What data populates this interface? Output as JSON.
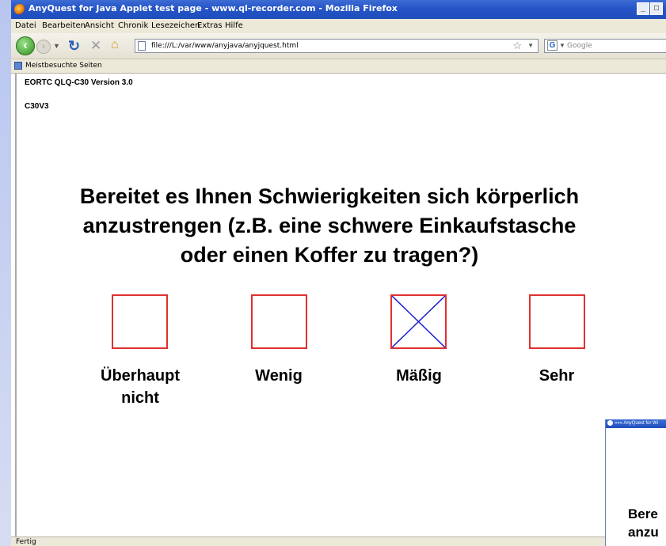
{
  "window": {
    "title": "AnyQuest for Java Applet test page - www.ql-recorder.com - Mozilla Firefox",
    "controls": [
      "_",
      "□"
    ]
  },
  "menu": [
    "Datei",
    "Bearbeiten",
    "Ansicht",
    "Chronik",
    "Lesezeichen",
    "Extras",
    "Hilfe"
  ],
  "toolbar": {
    "url": "file:///L:/var/www/anyjava/anyjquest.html",
    "search_placeholder": "Google",
    "search_engine_letter": "G"
  },
  "bookmarks": {
    "item": "Meistbesuchte Seiten"
  },
  "page": {
    "heading1": "EORTC QLQ-C30 Version 3.0",
    "heading2": "C30V3",
    "question_lines": [
      "Bereitet es Ihnen Schwierigkeiten sich körperlich",
      "anzustrengen (z.B. eine schwere Einkaufstasche",
      "oder einen Koffer zu tragen?)"
    ],
    "options": [
      {
        "line1": "Überhaupt",
        "line2": "nicht",
        "checked": false
      },
      {
        "line1": "Wenig",
        "line2": "",
        "checked": false
      },
      {
        "line1": "Mäßig",
        "line2": "",
        "checked": true
      },
      {
        "line1": "Sehr",
        "line2": "",
        "checked": false
      }
    ],
    "box_border_color": "#e03030",
    "check_color": "#1a1ad0"
  },
  "popup": {
    "title": "««« AnyQuest for Wi",
    "text_lines": [
      "Bere",
      "anzu"
    ]
  },
  "status": {
    "text": "Fertig"
  }
}
